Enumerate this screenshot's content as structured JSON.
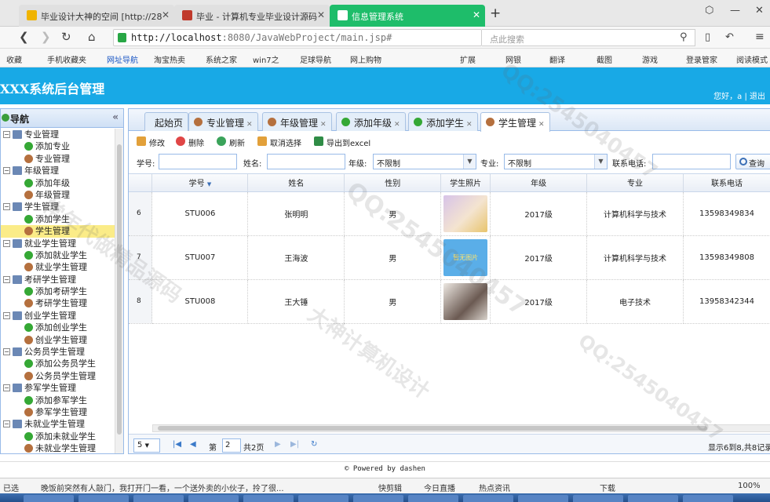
{
  "browser": {
    "tabs": [
      {
        "label": "毕业设计大神的空间 [http://28",
        "color": "#f0b400"
      },
      {
        "label": "毕业 - 计算机专业毕业设计源码",
        "color": "#c0392b"
      },
      {
        "label": "信息管理系统",
        "color": "#1ebd6a"
      }
    ],
    "url_host": "http://localhost",
    "url_rest": ":8080/JavaWebProject/main.jsp#",
    "search_placeholder": "点此搜索",
    "bookmarks": [
      "收藏",
      "手机收藏夹",
      "网址导航",
      "淘宝热卖",
      "系统之家",
      "win7之",
      "足球导航",
      "网上购物"
    ],
    "right_bookmarks": [
      "扩展",
      "网银",
      "翻译",
      "截图",
      "游戏",
      "登录管家",
      "阅读模式"
    ]
  },
  "app": {
    "title": "XXX系统后台管理",
    "greeting": "您好，a",
    "divider": "|",
    "logout": "退出",
    "nav_title": "导航",
    "collapse_glyph": "«"
  },
  "tree": [
    {
      "label": "专业管理",
      "children": [
        {
          "label": "添加专业",
          "icon": "add"
        },
        {
          "label": "专业管理",
          "icon": "user"
        }
      ]
    },
    {
      "label": "年级管理",
      "children": [
        {
          "label": "添加年级",
          "icon": "add"
        },
        {
          "label": "年级管理",
          "icon": "user"
        }
      ]
    },
    {
      "label": "学生管理",
      "children": [
        {
          "label": "添加学生",
          "icon": "add"
        },
        {
          "label": "学生管理",
          "icon": "user",
          "selected": true
        }
      ]
    },
    {
      "label": "就业学生管理",
      "children": [
        {
          "label": "添加就业学生",
          "icon": "add"
        },
        {
          "label": "就业学生管理",
          "icon": "user"
        }
      ]
    },
    {
      "label": "考研学生管理",
      "children": [
        {
          "label": "添加考研学生",
          "icon": "add"
        },
        {
          "label": "考研学生管理",
          "icon": "user"
        }
      ]
    },
    {
      "label": "创业学生管理",
      "children": [
        {
          "label": "添加创业学生",
          "icon": "add"
        },
        {
          "label": "创业学生管理",
          "icon": "user"
        }
      ]
    },
    {
      "label": "公务员学生管理",
      "children": [
        {
          "label": "添加公务员学生",
          "icon": "add"
        },
        {
          "label": "公务员学生管理",
          "icon": "user"
        }
      ]
    },
    {
      "label": "参军学生管理",
      "children": [
        {
          "label": "添加参军学生",
          "icon": "add"
        },
        {
          "label": "参军学生管理",
          "icon": "user"
        }
      ]
    },
    {
      "label": "未就业学生管理",
      "children": [
        {
          "label": "添加未就业学生",
          "icon": "add"
        },
        {
          "label": "未就业学生管理",
          "icon": "user"
        }
      ]
    }
  ],
  "page_tabs": [
    {
      "label": "起始页",
      "icon": "none",
      "closable": false
    },
    {
      "label": "专业管理",
      "icon": "user",
      "closable": true
    },
    {
      "label": "年级管理",
      "icon": "user",
      "closable": true
    },
    {
      "label": "添加年级",
      "icon": "add",
      "closable": true
    },
    {
      "label": "添加学生",
      "icon": "add",
      "closable": true
    },
    {
      "label": "学生管理",
      "icon": "user",
      "closable": true,
      "active": true
    }
  ],
  "toolbar": {
    "edit": "修改",
    "delete": "删除",
    "refresh": "刷新",
    "deselect": "取消选择",
    "export": "导出到excel"
  },
  "filters": {
    "student_no_label": "学号:",
    "name_label": "姓名:",
    "grade_label": "年级:",
    "grade_value": "不限制",
    "major_label": "专业:",
    "major_value": "不限制",
    "phone_label": "联系电话:",
    "query_button": "查询"
  },
  "table": {
    "columns": [
      "学号",
      "姓名",
      "性别",
      "学生照片",
      "年级",
      "专业",
      "联系电话"
    ],
    "sort_indicator": "▼",
    "rows": [
      {
        "rownum": "6",
        "id": "STU006",
        "name": "张明明",
        "gender": "男",
        "photo": "photo-girl",
        "grade": "2017级",
        "major": "计算机科学与技术",
        "phone": "13598349834"
      },
      {
        "rownum": "7",
        "id": "STU007",
        "name": "王海波",
        "gender": "男",
        "photo": "no-photo",
        "photo_text": "暂无图片",
        "grade": "2017级",
        "major": "计算机科学与技术",
        "phone": "13598349808"
      },
      {
        "rownum": "8",
        "id": "STU008",
        "name": "王大锤",
        "gender": "男",
        "photo": "photo-child",
        "grade": "2017级",
        "major": "电子技术",
        "phone": "13958342344"
      }
    ]
  },
  "pager": {
    "page_size": "5",
    "page_label": "第",
    "page_value": "2",
    "total_pages": "共2页",
    "summary": "显示6到8,共8记录"
  },
  "footer": "© Powered by dashen",
  "status": {
    "left": "已选",
    "news": "晚饭前突然有人敲门，我打开门一看，一个送外卖的小伙子，拎了很...",
    "items": [
      "快剪辑",
      "今日直播",
      "热点资讯"
    ],
    "download": "下载",
    "zoom": "100%"
  },
  "watermarks": [
    "毕业设计大神的空间",
    "QQ:2545040457",
    "大神计算机设计",
    "常年代做精品源码"
  ]
}
